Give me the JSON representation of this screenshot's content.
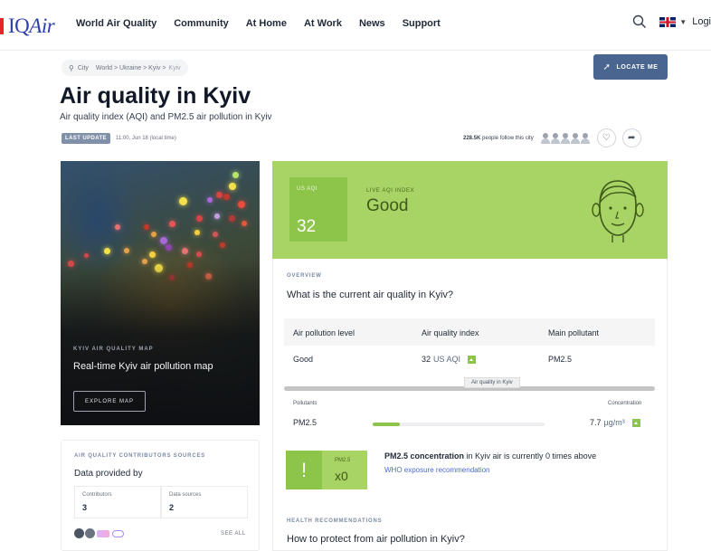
{
  "nav": {
    "logo_prefix": "IQ",
    "logo_suffix": "Air",
    "links": [
      "World Air Quality",
      "Community",
      "At Home",
      "At Work",
      "News",
      "Support"
    ],
    "login": "Logi"
  },
  "breadcrumb": {
    "city_label": "City",
    "path": "World > Ukraine > Kyiv >",
    "current": "Kyiv"
  },
  "locate_label": "LOCATE ME",
  "title": "Air quality in Kyiv",
  "subtitle": "Air quality index (AQI) and PM2.5 air pollution in Kyiv",
  "last_update": {
    "badge": "LAST UPDATE",
    "time": "11:00, Jun 18 (local time)"
  },
  "followers": {
    "count": "228.5K",
    "text": "people follow this city"
  },
  "map_card": {
    "label": "KYIV AIR QUALITY MAP",
    "title": "Real-time Kyiv air pollution map",
    "button": "EXPLORE MAP"
  },
  "contributors": {
    "label": "AIR QUALITY CONTRIBUTORS SOURCES",
    "title": "Data provided by",
    "stats": [
      {
        "label": "Contributors",
        "value": "3"
      },
      {
        "label": "Data sources",
        "value": "2"
      }
    ],
    "see_all": "SEE ALL"
  },
  "aqi": {
    "box_label": "US AQI",
    "value": "32",
    "live_label": "LIVE AQI INDEX",
    "status": "Good",
    "colors": {
      "panel": "#a8d365",
      "box": "#8dc44a"
    }
  },
  "overview": {
    "label": "OVERVIEW",
    "question": "What is the current air quality in Kyiv?",
    "headers": [
      "Air pollution level",
      "Air quality index",
      "Main pollutant"
    ],
    "row": {
      "level": "Good",
      "aqi_value": "32",
      "aqi_unit": "US AQI",
      "pollutant": "PM2.5"
    },
    "tooltip": "Air quality in Kyiv",
    "pollutants_label": "Pollutants",
    "concentration_label": "Concentration",
    "pollutant_row": {
      "name": "PM2.5",
      "value": "7.7",
      "unit": "µg/m³",
      "level_fraction": 0.16
    },
    "warning": {
      "icon": "!",
      "label": "PM2.5",
      "value": "x0"
    },
    "concentration_bold": "PM2.5 concentration",
    "concentration_rest": " in Kyiv air is currently 0 times above",
    "who_link": "WHO exposure recommendation"
  },
  "health": {
    "label": "HEALTH RECOMMENDATIONS",
    "question": "How to protect from air pollution in Kyiv?"
  }
}
